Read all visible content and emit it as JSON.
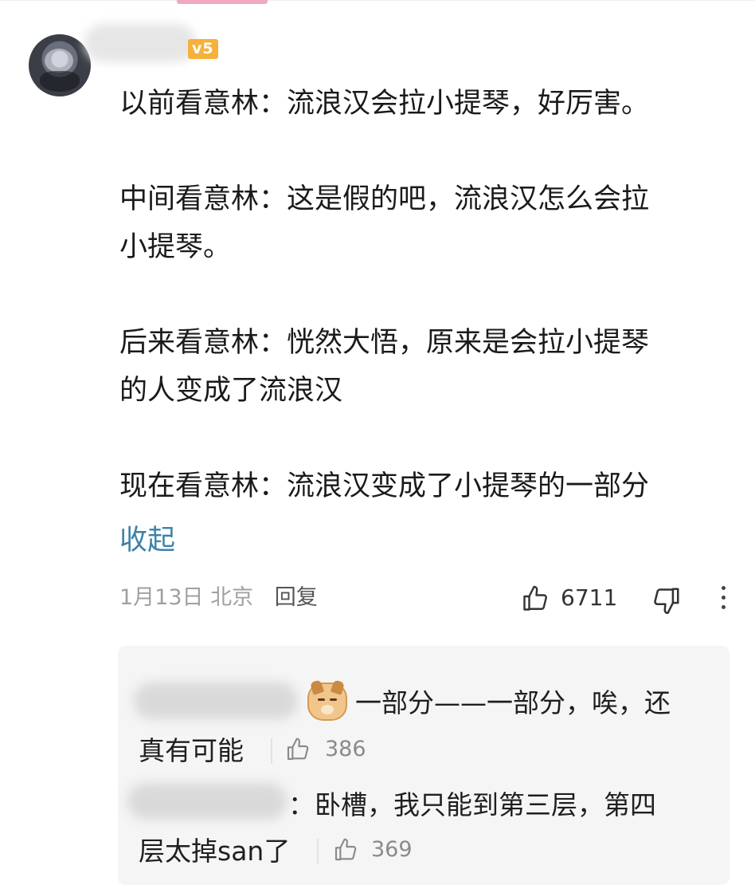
{
  "comment": {
    "vip_badge": "v5",
    "paragraphs": [
      [
        "以前看意林：流浪汉会拉小提琴，好厉害。"
      ],
      [
        "中间看意林：这是假的吧，流浪汉怎么会拉",
        "小提琴。"
      ],
      [
        "后来看意林：恍然大悟，原来是会拉小提琴",
        "的人变成了流浪汉"
      ],
      [
        "现在看意林：流浪汉变成了小提琴的一部分"
      ]
    ],
    "collapse_label": "收起",
    "date": "1月13日",
    "location": "北京",
    "reply_label": "回复",
    "like_count": "6711"
  },
  "replies": [
    {
      "lines": [
        "一部分——一部分，唉，还",
        "真有可能"
      ],
      "like_count": "386"
    },
    {
      "lines": [
        "：卧槽，我只能到第三层，第四",
        "层太掉san了"
      ],
      "like_count": "369"
    }
  ],
  "icons": {
    "like": "thumbs-up-icon",
    "dislike": "thumbs-down-icon",
    "more": "vertical-dots-icon",
    "emoji": "dog-emoji-icon"
  },
  "colors": {
    "link": "#3d82a8",
    "vip": "#f5b13c",
    "meta": "#a0a0a0",
    "reply_bg": "#f5f5f5"
  }
}
